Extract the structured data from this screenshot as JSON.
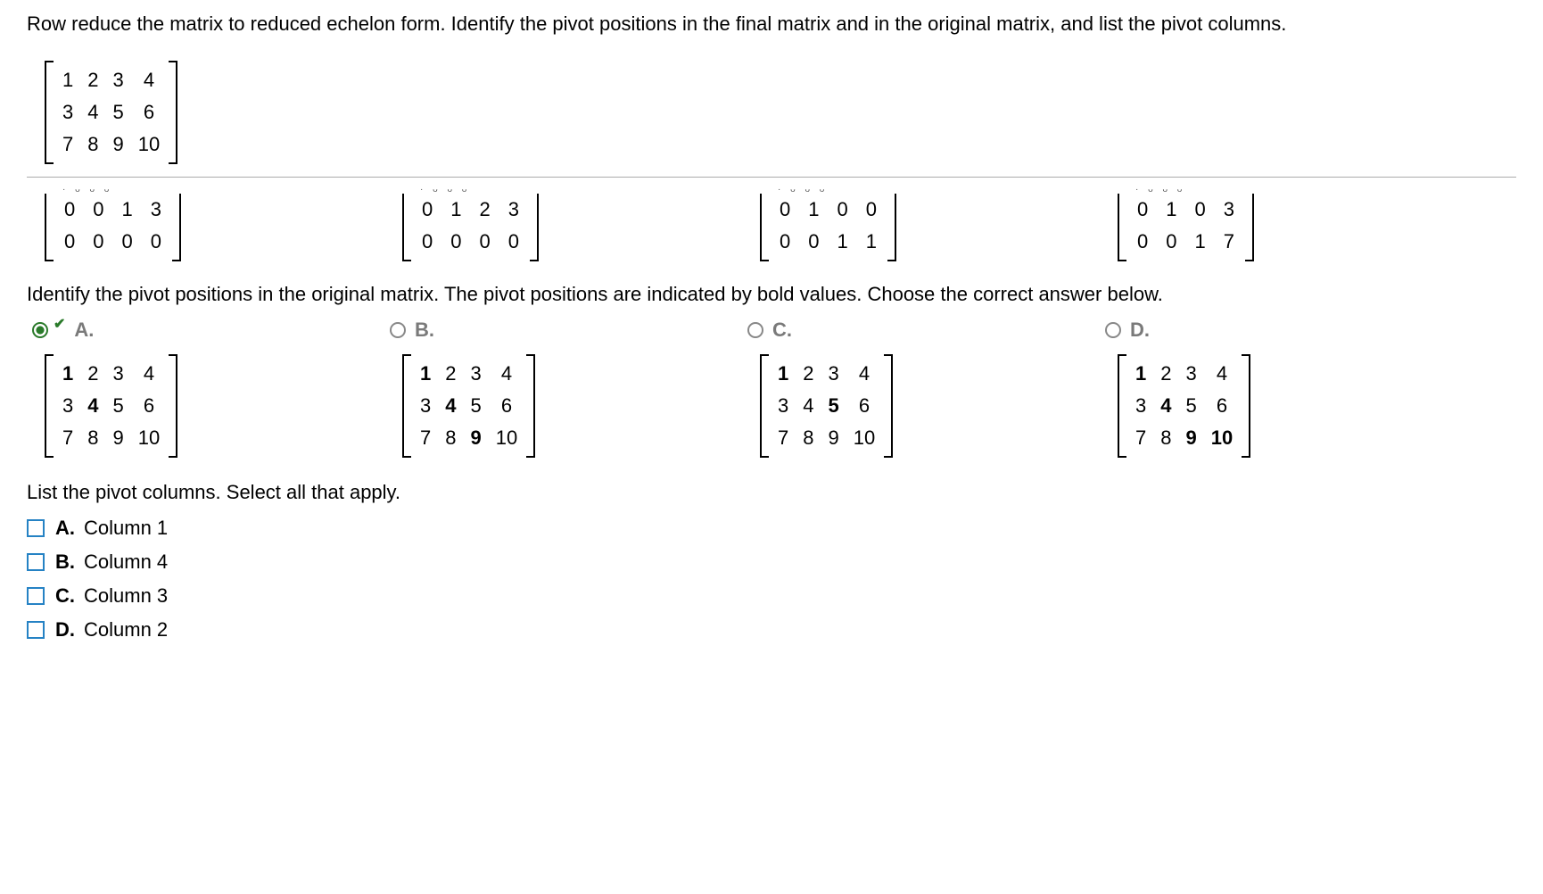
{
  "question_text": "Row reduce the matrix to reduced echelon form. Identify the pivot positions in the final matrix and in the original matrix, and list the pivot columns.",
  "main_matrix": {
    "rows": [
      [
        "1",
        "2",
        "3",
        "4"
      ],
      [
        "3",
        "4",
        "5",
        "6"
      ],
      [
        "7",
        "8",
        "9",
        "10"
      ]
    ]
  },
  "partial_matrices": [
    {
      "rows": [
        [
          "0",
          "0",
          "1",
          "3"
        ],
        [
          "0",
          "0",
          "0",
          "0"
        ]
      ]
    },
    {
      "rows": [
        [
          "0",
          "1",
          "2",
          "3"
        ],
        [
          "0",
          "0",
          "0",
          "0"
        ]
      ]
    },
    {
      "rows": [
        [
          "0",
          "1",
          "0",
          "0"
        ],
        [
          "0",
          "0",
          "1",
          "1"
        ]
      ]
    },
    {
      "rows": [
        [
          "0",
          "1",
          "0",
          "3"
        ],
        [
          "0",
          "0",
          "1",
          "7"
        ]
      ]
    }
  ],
  "section2_text": "Identify the pivot positions in the original matrix. The pivot positions are indicated by bold values. Choose the correct answer below.",
  "options2": [
    {
      "letter": "A.",
      "selected": true,
      "bold": [
        [
          0,
          0
        ],
        [
          1,
          1
        ]
      ]
    },
    {
      "letter": "B.",
      "selected": false,
      "bold": [
        [
          0,
          0
        ],
        [
          1,
          1
        ],
        [
          2,
          2
        ]
      ]
    },
    {
      "letter": "C.",
      "selected": false,
      "bold": [
        [
          0,
          0
        ],
        [
          1,
          2
        ]
      ]
    },
    {
      "letter": "D.",
      "selected": false,
      "bold": [
        [
          0,
          0
        ],
        [
          1,
          1
        ],
        [
          2,
          2
        ],
        [
          2,
          3
        ]
      ]
    }
  ],
  "shared_matrix_rows": [
    [
      "1",
      "2",
      "3",
      "4"
    ],
    [
      "3",
      "4",
      "5",
      "6"
    ],
    [
      "7",
      "8",
      "9",
      "10"
    ]
  ],
  "section3_text": "List the pivot columns. Select all that apply.",
  "checkboxes": [
    {
      "letter": "A.",
      "label": "Column 1"
    },
    {
      "letter": "B.",
      "label": "Column 4"
    },
    {
      "letter": "C.",
      "label": "Column 3"
    },
    {
      "letter": "D.",
      "label": "Column 2"
    }
  ]
}
